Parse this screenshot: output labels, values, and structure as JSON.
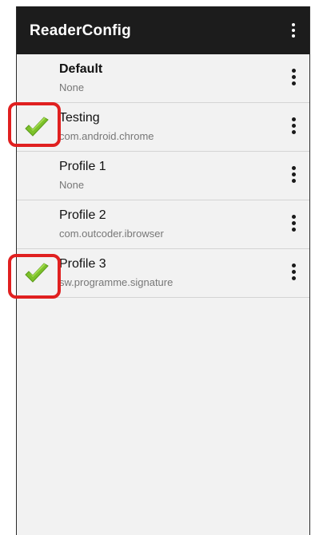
{
  "app": {
    "title": "ReaderConfig"
  },
  "appbar": {
    "overflow_icon": "more-vert-icon"
  },
  "profiles": [
    {
      "name": "Default",
      "package": "None",
      "bold": true,
      "checked": false
    },
    {
      "name": "Testing",
      "package": "com.android.chrome",
      "bold": false,
      "checked": true
    },
    {
      "name": "Profile 1",
      "package": "None",
      "bold": false,
      "checked": false
    },
    {
      "name": "Profile 2",
      "package": "com.outcoder.ibrowser",
      "bold": false,
      "checked": false
    },
    {
      "name": "Profile 3",
      "package": "sw.programme.signature",
      "bold": false,
      "checked": true
    }
  ],
  "icons": {
    "check": "checkmark-icon",
    "row_menu": "more-vert-icon"
  },
  "colors": {
    "appbar": "#1c1c1c",
    "check": "#7cc12a",
    "highlight": "#e02020"
  }
}
